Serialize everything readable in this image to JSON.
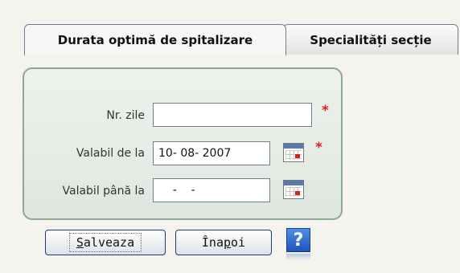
{
  "tabs": [
    {
      "label": "Durata optimă de spitalizare",
      "active": true
    },
    {
      "label": "Specialități secție",
      "active": false
    }
  ],
  "form": {
    "nr_zile": {
      "label": "Nr. zile",
      "value": "",
      "required": true
    },
    "valabil_de_la": {
      "label": "Valabil de la",
      "value": "10- 08- 2007",
      "required": true
    },
    "valabil_pana_la": {
      "label": "Valabil până la",
      "value": "    -    -",
      "required": false
    },
    "required_mark": "*"
  },
  "buttons": {
    "save_first": "S",
    "save_rest": "alveaza",
    "back_first": "Îna",
    "back_under": "p",
    "back_rest": "oi",
    "help": "?"
  },
  "colors": {
    "required": "#e02020",
    "help_bg": "#1e55b8",
    "panel_border": "#8fa69b"
  },
  "icons": [
    "calendar-icon",
    "help-icon"
  ]
}
